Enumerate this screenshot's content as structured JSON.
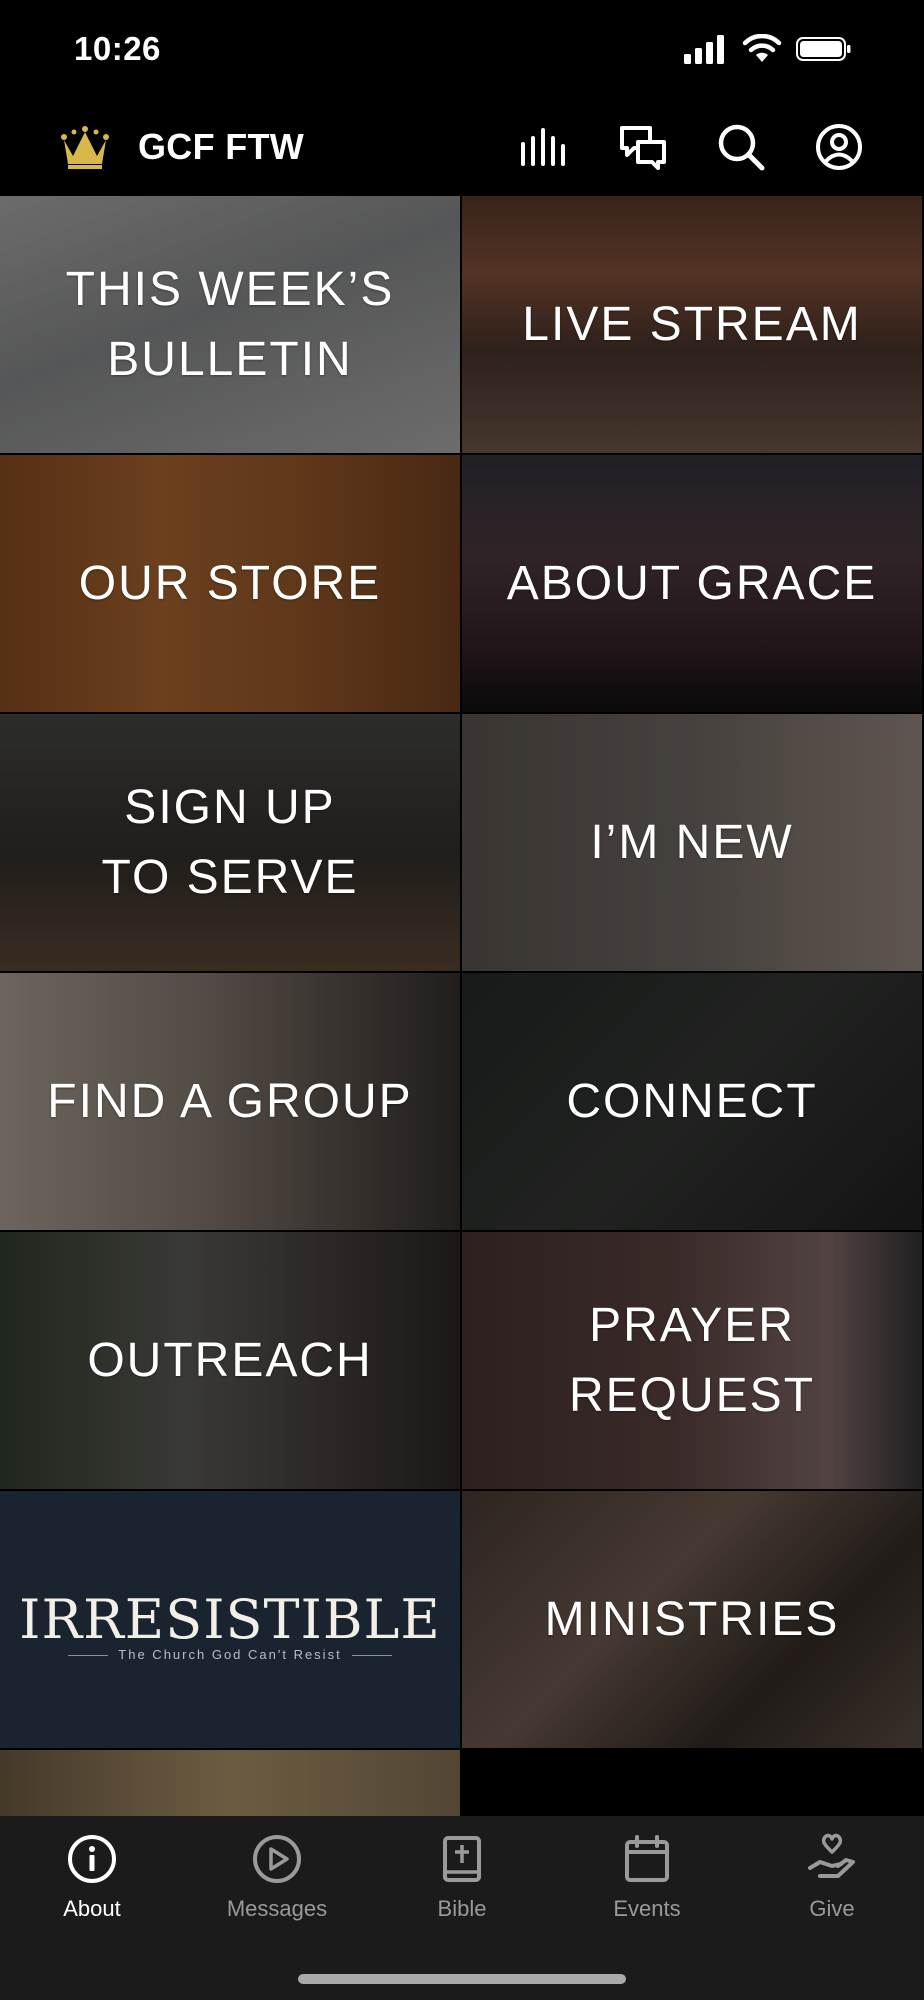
{
  "status": {
    "time": "10:26"
  },
  "header": {
    "title": "GCF FTW"
  },
  "tiles": [
    {
      "label": "THIS WEEK’S\nBULLETIN"
    },
    {
      "label": "LIVE STREAM"
    },
    {
      "label": "OUR STORE"
    },
    {
      "label": "ABOUT GRACE"
    },
    {
      "label": "SIGN UP\nTO SERVE"
    },
    {
      "label": "I’M NEW"
    },
    {
      "label": "FIND A GROUP"
    },
    {
      "label": "CONNECT"
    },
    {
      "label": "OUTREACH"
    },
    {
      "label": "PRAYER\nREQUEST"
    },
    {
      "label": "IRRESISTIBLE",
      "subtitle": "The Church God Can't Resist"
    },
    {
      "label": "MINISTRIES"
    }
  ],
  "tabs": [
    {
      "label": "About",
      "icon": "info-icon",
      "active": true
    },
    {
      "label": "Messages",
      "icon": "play-icon",
      "active": false
    },
    {
      "label": "Bible",
      "icon": "bible-icon",
      "active": false
    },
    {
      "label": "Events",
      "icon": "calendar-icon",
      "active": false
    },
    {
      "label": "Give",
      "icon": "give-icon",
      "active": false
    }
  ],
  "colors": {
    "accent": "#d8b84a",
    "tab_active": "#ffffff",
    "tab_inactive": "#9a9a9a",
    "tab_bar_bg": "#1b1b1b"
  }
}
